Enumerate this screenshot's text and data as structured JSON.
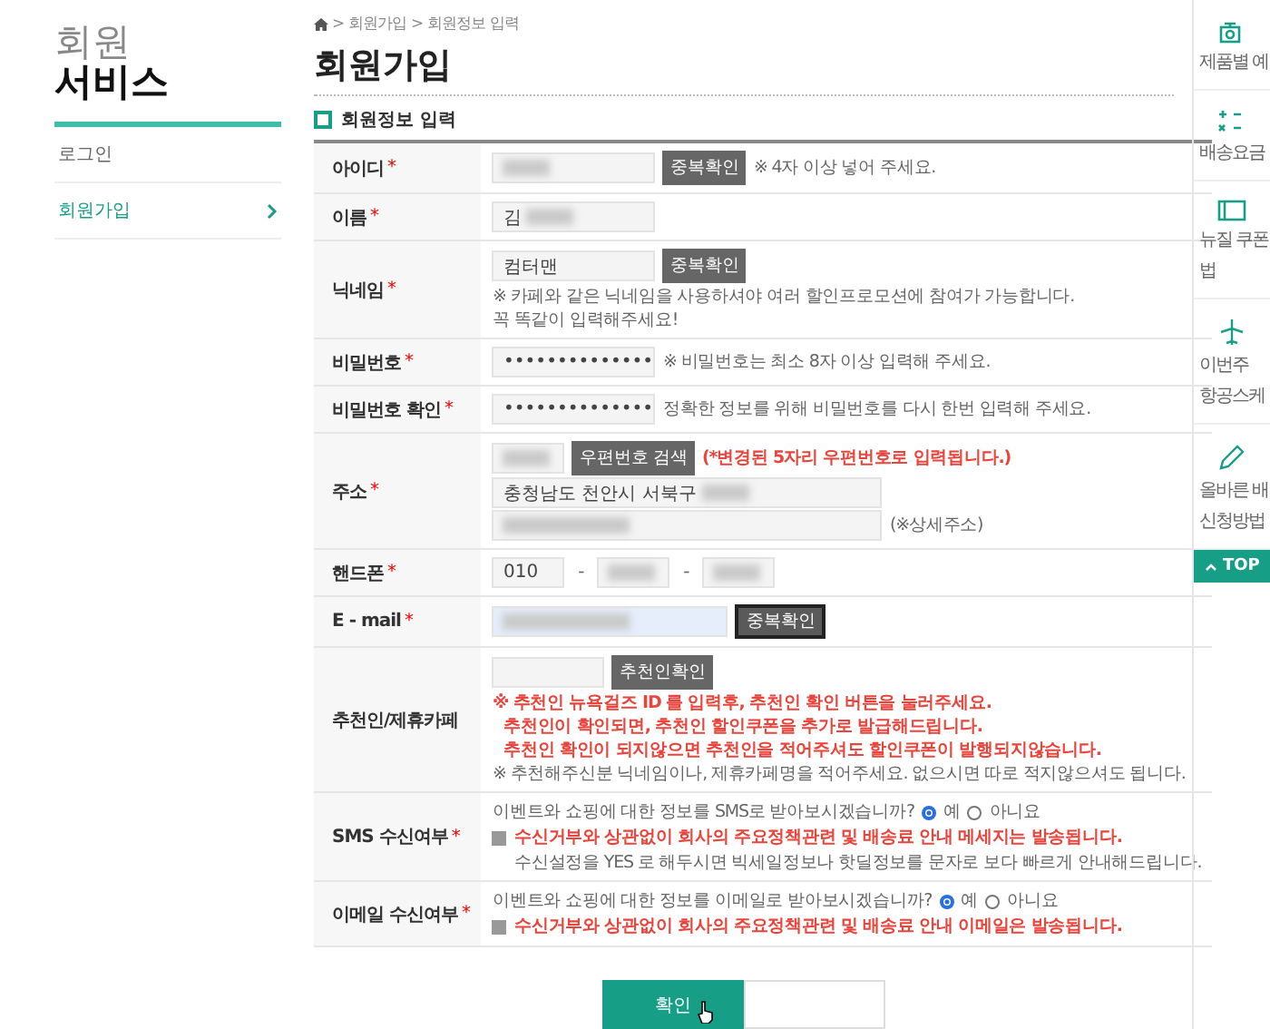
{
  "sidebar": {
    "title_light": "회원",
    "title_bold": "서비스",
    "items": [
      {
        "label": "로그인",
        "selected": false
      },
      {
        "label": "회원가입",
        "selected": true
      }
    ]
  },
  "breadcrumb": "> 회원가입 > 회원정보 입력",
  "page_title": "회원가입",
  "section_title": "회원정보 입력",
  "rows": [
    {
      "kind": "text-button",
      "label": "아이디",
      "required_mark": "*",
      "input": {
        "blurred": true
      },
      "button": "중복확인",
      "note": "※ 4자 이상 넣어 주세요."
    },
    {
      "kind": "text",
      "label": "이름",
      "required_mark": "*",
      "input": {
        "value": "김",
        "blurred": true
      }
    },
    {
      "kind": "text-button",
      "label": "닉네임",
      "required_mark": "*",
      "input": {
        "value": "컴터맨",
        "blurred": false
      },
      "button": "중복확인",
      "notes_below": [
        "※ 카페와 같은 닉네임을 사용하셔야 여러 할인프로모션에 참여가 가능합니다.",
        "꼭 똑같이 입력해주세요!"
      ]
    },
    {
      "kind": "text",
      "label": "비밀번호",
      "required_mark": "*",
      "input": {
        "value": "••••••••••••••"
      },
      "note": "※ 비밀번호는 최소 8자 이상 입력해 주세요."
    },
    {
      "kind": "text",
      "label": "비밀번호 확인",
      "required_mark": "*",
      "input": {
        "value": "••••••••••••••"
      },
      "note": "정확한 정보를 위해 비밀번호를 다시 한번 입력해 주세요."
    },
    {
      "kind": "address",
      "label": "주소",
      "required_mark": "*",
      "zip": {
        "blurred": true
      },
      "button": "우편번호 검색",
      "alert": "(*변경된 5자리 우편번호로 입력됩니다.)",
      "line1": {
        "value": "충청남도 천안시 서북구",
        "blurred": true
      },
      "line2": {
        "blurred": true
      },
      "suffix": "(※상세주소)"
    },
    {
      "kind": "phone",
      "label": "핸드폰",
      "required_mark": "*",
      "parts": [
        {
          "value": "010",
          "blurred": false
        },
        {
          "blurred": true
        },
        {
          "blurred": true
        }
      ],
      "separators": [
        "-",
        "-"
      ]
    },
    {
      "kind": "text-button",
      "label": "E - mail",
      "required_mark": "*",
      "input": {
        "blurred": true,
        "focused": true
      },
      "button": "중복확인"
    },
    {
      "kind": "referral",
      "label": "추천인/제휴카페",
      "input": {
        "blurred": false
      },
      "button": "추천인확인",
      "warnings": [
        "※ 추천인 뉴욕걸즈 ID 를 입력후, 추천인 확인 버튼을 눌러주세요.",
        "추천인이 확인되면, 추천인 할인쿠폰을 추가로 발급해드립니다.",
        "추천인 확인이 되지않으면 추천인을 적어주셔도 할인쿠폰이 발행되지않습니다."
      ],
      "note": "※ 추천해주신분 닉네임이나, 제휴카페명을 적어주세요. 없으시면 따로 적지않으셔도 됩니다."
    },
    {
      "kind": "consent",
      "label": "SMS 수신여부",
      "required_mark": "*",
      "question": "이벤트와 쇼핑에 대한 정보를 SMS로 받아보시겠습니까?",
      "options": [
        {
          "label": "예",
          "selected": true
        },
        {
          "label": "아니요",
          "selected": false
        }
      ],
      "warning": "수신거부와 상관없이 회사의 주요정책관련 및 배송료 안내 메세지는 발송됩니다.",
      "note": "수신설정을 YES 로 해두시면 빅세일정보나 핫딜정보를 문자로 보다 빠르게 안내해드립니다."
    },
    {
      "kind": "consent",
      "label": "이메일 수신여부",
      "required_mark": "*",
      "question": "이벤트와 쇼핑에 대한 정보를 이메일로 받아보시겠습니까?",
      "options": [
        {
          "label": "예",
          "selected": true
        },
        {
          "label": "아니요",
          "selected": false
        }
      ],
      "warning": "수신거부와 상관없이 회사의 주요정책관련 및 배송료 안내 이메일은 발송됩니다."
    }
  ],
  "buttons": [
    {
      "kind": "primary",
      "label": "확인"
    },
    {
      "kind": "secondary"
    }
  ],
  "quick_menu": [
    {
      "kind": "scale",
      "lines": [
        "제품별 예"
      ]
    },
    {
      "kind": "calc",
      "lines": [
        "배송요금"
      ]
    },
    {
      "kind": "coupon",
      "lines": [
        "뉴질 쿠폰",
        "법"
      ]
    },
    {
      "kind": "plane",
      "lines": [
        "이번주",
        "항공스케"
      ]
    },
    {
      "kind": "pencil",
      "lines": [
        "올바른 배",
        "신청방법"
      ]
    }
  ],
  "top_button": "TOP"
}
